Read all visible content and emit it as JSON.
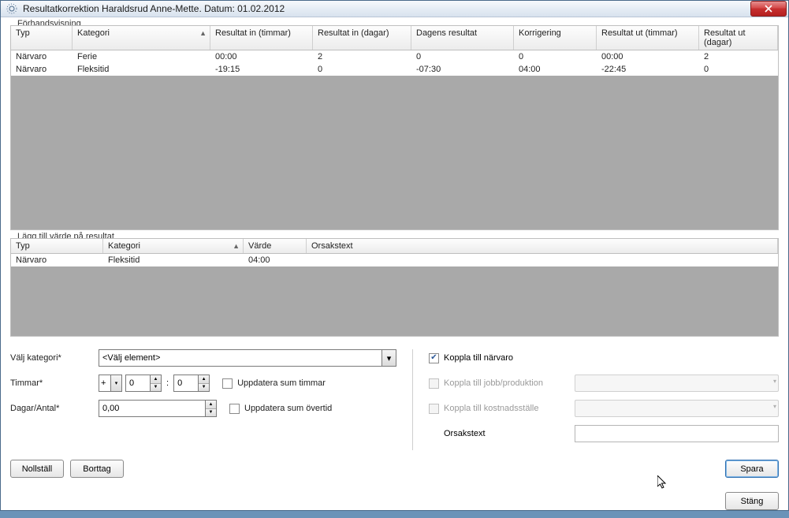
{
  "window": {
    "title": "Resultatkorrektion Haraldsrud Anne-Mette. Datum: 01.02.2012"
  },
  "section1": {
    "title": "Förhandsvisning",
    "headers": {
      "c1": "Typ",
      "c2": "Kategori",
      "c3": "Resultat in (timmar)",
      "c4": "Resultat in (dagar)",
      "c5": "Dagens resultat",
      "c6": "Korrigering",
      "c7": "Resultat ut (timmar)",
      "c8": "Resultat ut (dagar)"
    },
    "rows": [
      {
        "c1": "Närvaro",
        "c2": "Ferie",
        "c3": "00:00",
        "c4": "2",
        "c5": "0",
        "c6": "0",
        "c7": "00:00",
        "c8": "2"
      },
      {
        "c1": "Närvaro",
        "c2": "Fleksitid",
        "c3": "-19:15",
        "c4": "0",
        "c5": "-07:30",
        "c6": "04:00",
        "c7": "-22:45",
        "c8": "0"
      }
    ]
  },
  "section2": {
    "title": "Lägg till värde på resultat",
    "headers": {
      "c1": "Typ",
      "c2": "Kategori",
      "c3": "Värde",
      "c4": "Orsakstext"
    },
    "rows": [
      {
        "c1": "Närvaro",
        "c2": "Fleksitid",
        "c3": "04:00",
        "c4": ""
      }
    ]
  },
  "form": {
    "category_label": "Välj kategori*",
    "category_value": "<Välj element>",
    "hours_label": "Timmar*",
    "sign_value": "+",
    "hours_h": "0",
    "hours_m": "0",
    "update_hours_label": "Uppdatera sum timmar",
    "days_label": "Dagar/Antal*",
    "days_value": "0,00",
    "update_ot_label": "Uppdatera sum övertid",
    "link_presence_label": "Koppla till närvaro",
    "link_presence_checked": true,
    "link_job_label": "Koppla till jobb/produktion",
    "link_cost_label": "Koppla till kostnadsställe",
    "reason_label": "Orsakstext"
  },
  "buttons": {
    "reset": "Nollställ",
    "delete": "Borttag",
    "save": "Spara",
    "close": "Stäng"
  }
}
